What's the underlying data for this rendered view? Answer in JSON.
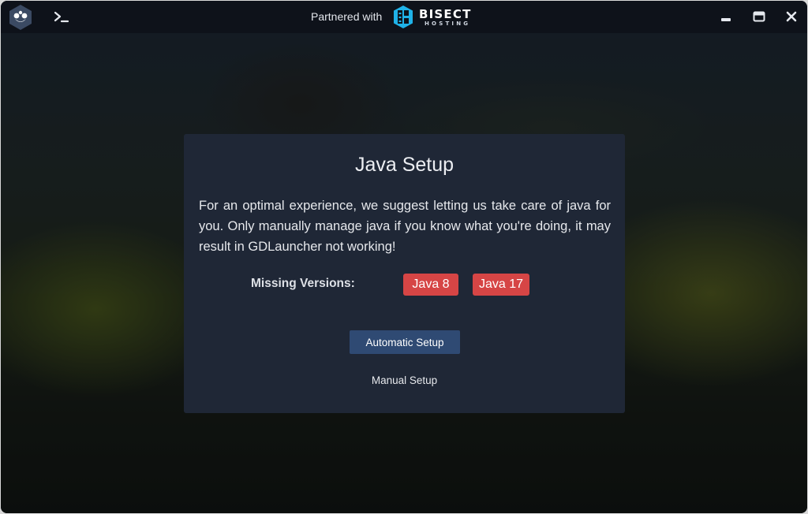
{
  "titlebar": {
    "partner_text": "Partnered with",
    "partner_brand": "BISECT",
    "partner_brand_sub": "HOSTING",
    "icons": {
      "app_logo": "gdlauncher-logo-icon",
      "terminal": "terminal-icon",
      "minimize": "minimize-icon",
      "maximize": "maximize-icon",
      "close": "close-icon"
    }
  },
  "modal": {
    "title": "Java Setup",
    "description": "For an optimal experience, we suggest letting us take care of java for you. Only manually manage java if you know what you're doing, it may result in GDLauncher not working!",
    "missing_label": "Missing Versions:",
    "missing_versions": [
      "Java 8",
      "Java 17"
    ],
    "primary_button": "Automatic Setup",
    "secondary_button": "Manual Setup"
  },
  "colors": {
    "titlebar_bg": "#0e121a",
    "modal_bg": "#1f2736",
    "badge_bg": "#d64545",
    "primary_button_bg": "#2f4a73",
    "bisect_accent": "#1fb2e8"
  }
}
